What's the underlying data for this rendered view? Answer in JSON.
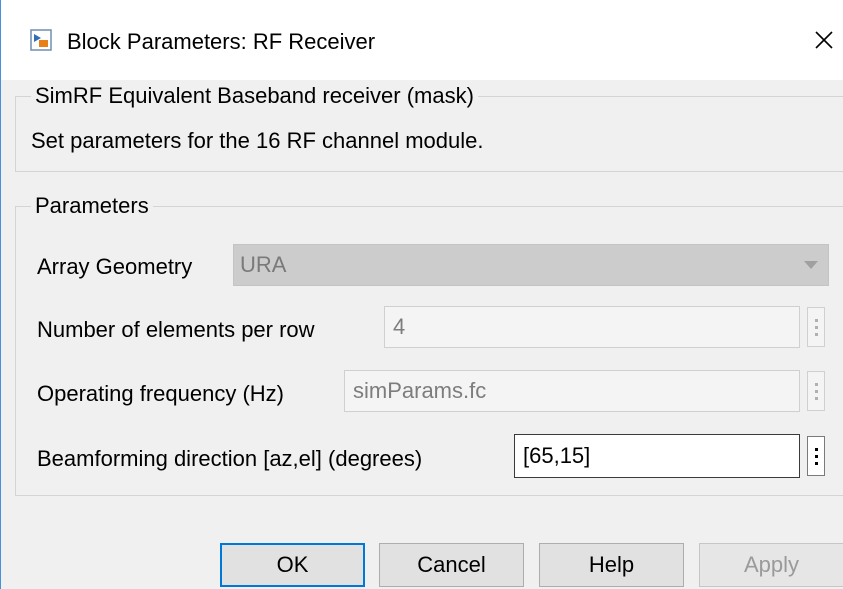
{
  "window": {
    "title": "Block Parameters: RF Receiver",
    "icon": "simulink-block-icon",
    "close_icon": "close-icon"
  },
  "mask_group": {
    "legend": "SimRF Equivalent Baseband receiver (mask)",
    "description": "Set parameters for the 16 RF channel module."
  },
  "parameters_group": {
    "legend": "Parameters",
    "array_geometry": {
      "label": "Array Geometry",
      "value": "URA",
      "enabled": false
    },
    "elements_per_row": {
      "label": "Number of elements per row",
      "value": "4",
      "enabled": false
    },
    "operating_frequency": {
      "label": "Operating frequency (Hz)",
      "value": "simParams.fc",
      "enabled": false
    },
    "beamforming_direction": {
      "label": "Beamforming direction [az,el] (degrees)",
      "value": "[65,15]",
      "enabled": true
    }
  },
  "buttons": {
    "ok": "OK",
    "cancel": "Cancel",
    "help": "Help",
    "apply": "Apply"
  },
  "colors": {
    "accent": "#0078d7",
    "window_border": "#4a90d9"
  }
}
